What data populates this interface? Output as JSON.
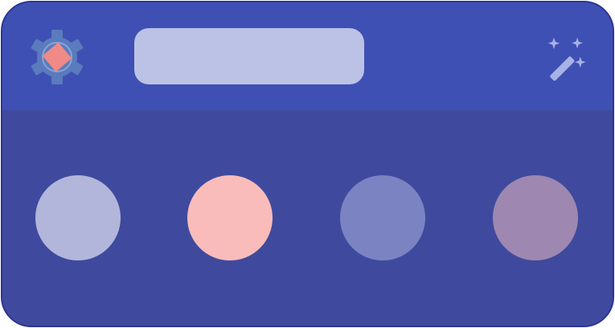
{
  "colors": {
    "frame_border": "#2c3591",
    "header_bg": "#3e50b4",
    "body_bg": "#3f4a9e",
    "search_field_bg": "#bcc2e6",
    "gear": "#5a7bbd",
    "gear_dark": "#45639f",
    "app_diamond": "#ef8a86",
    "wand": "#a9b2e6"
  },
  "header": {
    "app_icon": "settings-gear-with-rotation-diamond",
    "search": {
      "value": "",
      "placeholder": ""
    },
    "action_icon": "magic-wand-sparkles"
  },
  "swatches": [
    {
      "name": "swatch-1",
      "color": "#b2b6da"
    },
    {
      "name": "swatch-2",
      "color": "#f9bcba"
    },
    {
      "name": "swatch-3",
      "color": "#7b83c2"
    },
    {
      "name": "swatch-4",
      "color": "#9e87b0"
    }
  ]
}
